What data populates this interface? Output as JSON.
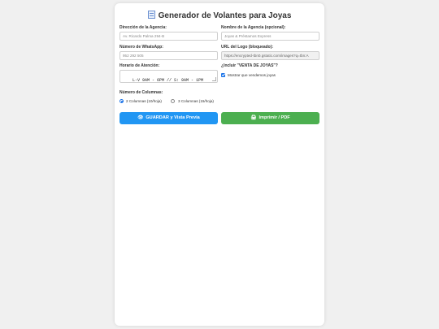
{
  "page": {
    "title": "Generador de Volantes para Joyas"
  },
  "form": {
    "address_label": "Dirección de la Agencia:",
    "address_placeholder": "Av. Ricardo Palma 294-B",
    "agency_label": "Nombre de la Agencia (opcional):",
    "agency_placeholder": "Joyas & Préstamos Express",
    "whatsapp_label": "Número de WhatsApp:",
    "whatsapp_placeholder": "952 292 505",
    "logo_label": "URL del Logo (bloqueado):",
    "logo_value": "https://encrypted-tbn0.gstatic.com/images?q=tbn:A",
    "hours_label": "Horario de Atención:",
    "hours_value": "L-V 9AM - 6PM // S: 9AM - 1PM",
    "include_label": "¿Incluir \"VENTA DE JOYAS\"?",
    "include_checkbox_label": "Mostrar que vendemos joyas",
    "include_checked": true,
    "columns_label": "Número de Columnas:",
    "columns_options": [
      "2 Columnas (10/hoja)",
      "3 Columnas (15/hoja)"
    ],
    "columns_selected": "2 Columnas (10/hoja)"
  },
  "actions": {
    "save_label": "GUARDAR y Vista Previa",
    "print_label": "Imprimir / PDF"
  },
  "colors": {
    "save_button": "#2196f3",
    "print_button": "#4caf50",
    "accent": "#1a73e8"
  }
}
